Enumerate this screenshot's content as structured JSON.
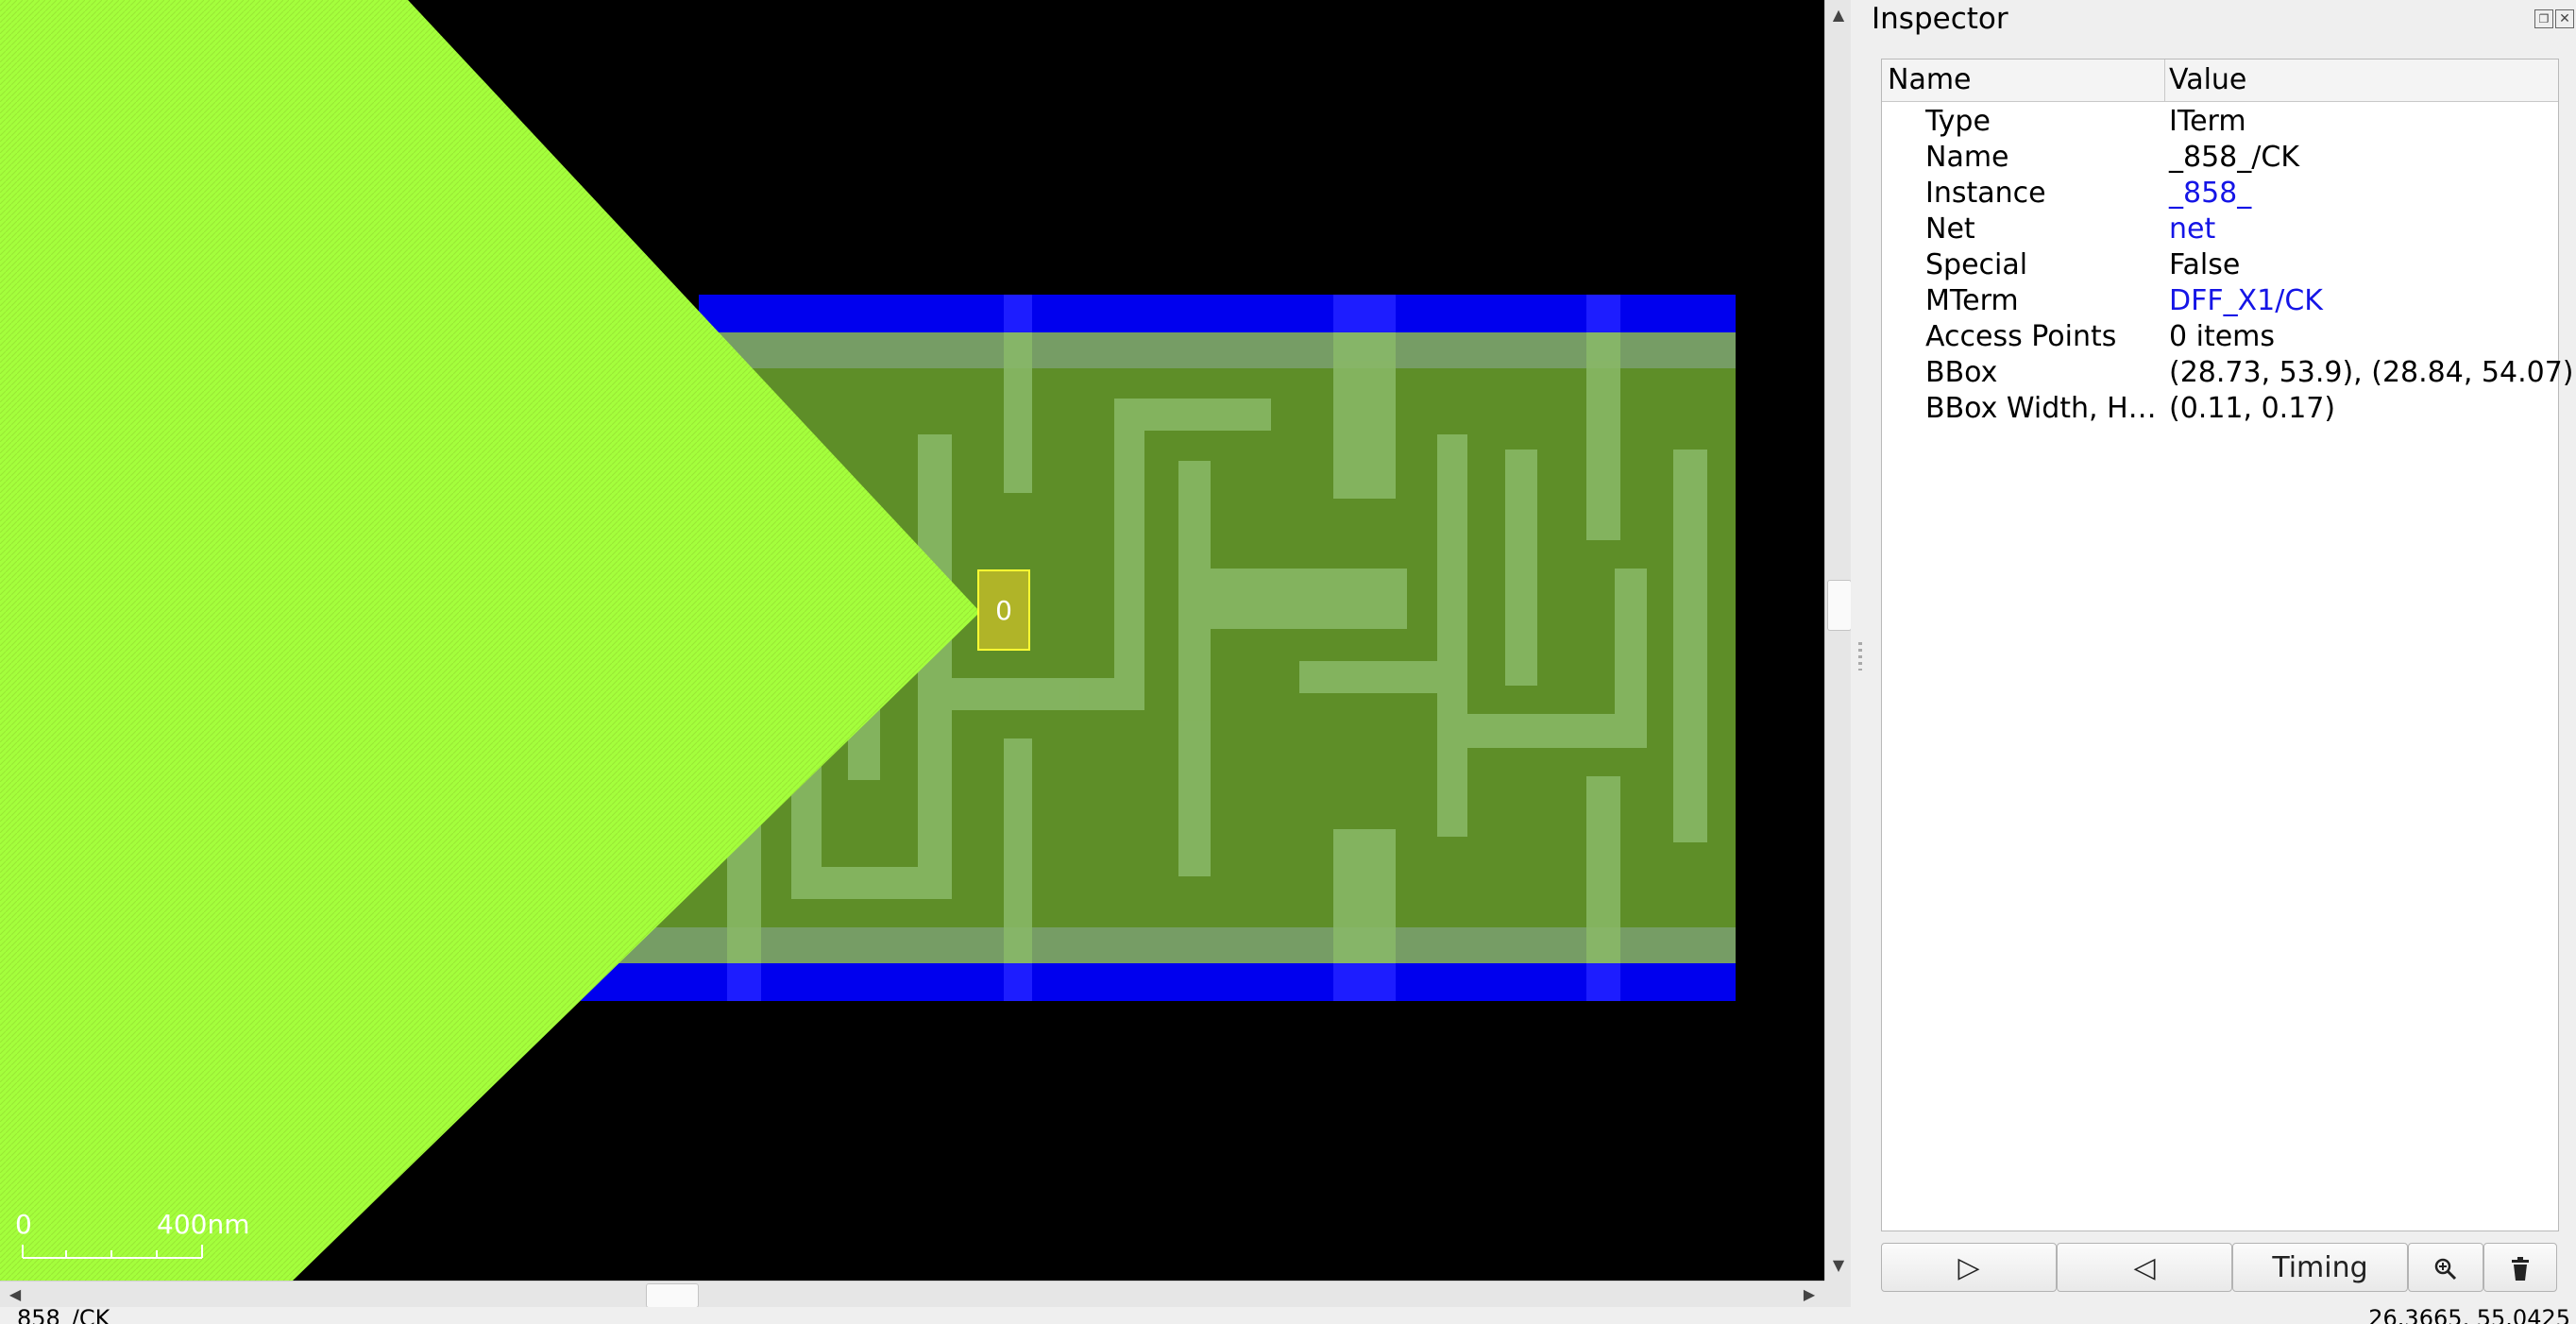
{
  "viewer": {
    "scale_bar": {
      "start_label": "0",
      "end_label": "400nm"
    },
    "pin_label": "0",
    "colors": {
      "background": "#000000",
      "highlight_fan": "#a4ff3c",
      "rail_metal": "#0000ee",
      "cell_body": "#5e8e28",
      "pin_box": "#d7d708"
    }
  },
  "status_bar": {
    "left_text": "_858_/CK",
    "right_text": "26.3665, 55.0425"
  },
  "inspector": {
    "title": "Inspector",
    "columns": {
      "name": "Name",
      "value": "Value"
    },
    "properties": [
      {
        "name": "Type",
        "value": "ITerm",
        "is_link": false
      },
      {
        "name": "Name",
        "value": "_858_/CK",
        "is_link": false
      },
      {
        "name": "Instance",
        "value": "_858_",
        "is_link": true
      },
      {
        "name": "Net",
        "value": "net",
        "is_link": true
      },
      {
        "name": "Special",
        "value": "False",
        "is_link": false
      },
      {
        "name": "MTerm",
        "value": "DFF_X1/CK",
        "is_link": true
      },
      {
        "name": "Access Points",
        "value": "0 items",
        "is_link": false
      },
      {
        "name": "BBox",
        "value": "(28.73, 53.9), (28.84, 54.07)",
        "is_link": false
      },
      {
        "name": "BBox Width, H…",
        "value": "(0.11, 0.17)",
        "is_link": false
      }
    ],
    "buttons": {
      "next_icon": "play-right-icon",
      "prev_icon": "play-left-icon",
      "timing_label": "Timing",
      "zoom_icon": "zoom-icon",
      "delete_icon": "trash-icon"
    }
  }
}
